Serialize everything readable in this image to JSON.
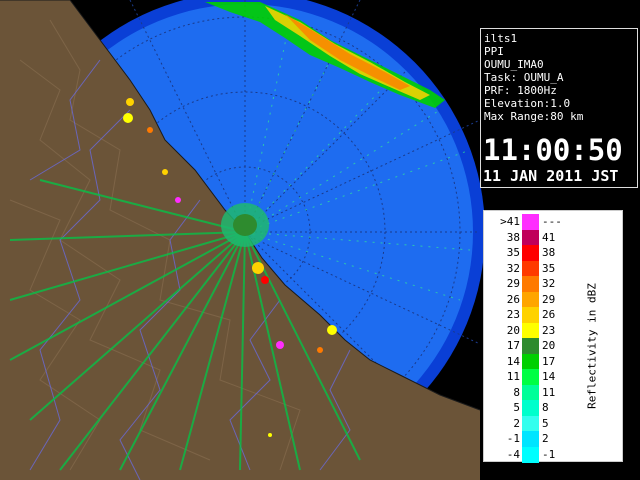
{
  "info_panel": {
    "site": "ilts1",
    "mode": "PPI",
    "product": "OUMU_IMA0",
    "task": "Task: OUMU_A",
    "prf": "PRF: 1800Hz",
    "elevation": "Elevation:1.0",
    "max_range": "Max Range:80 km",
    "time": "11:00:50",
    "date": "11 JAN 2011 JST"
  },
  "legend": {
    "title": "Reflectivity in dBZ",
    "rows": [
      {
        "lo": ">41",
        "hi": "---",
        "color": "#ff2dff"
      },
      {
        "lo": "38",
        "hi": "41",
        "color": "#c0005a"
      },
      {
        "lo": "35",
        "hi": "38",
        "color": "#ff0000"
      },
      {
        "lo": "32",
        "hi": "35",
        "color": "#ff3a00"
      },
      {
        "lo": "29",
        "hi": "32",
        "color": "#ff7a00"
      },
      {
        "lo": "26",
        "hi": "29",
        "color": "#ffa500"
      },
      {
        "lo": "23",
        "hi": "26",
        "color": "#ffd200"
      },
      {
        "lo": "20",
        "hi": "23",
        "color": "#ffff00"
      },
      {
        "lo": "17",
        "hi": "20",
        "color": "#2e8b2e"
      },
      {
        "lo": "14",
        "hi": "17",
        "color": "#00d000"
      },
      {
        "lo": "11",
        "hi": "14",
        "color": "#00ff44"
      },
      {
        "lo": "8",
        "hi": "11",
        "color": "#00ff99"
      },
      {
        "lo": "5",
        "hi": "8",
        "color": "#00ffcc"
      },
      {
        "lo": "2",
        "hi": "5",
        "color": "#33ffee"
      },
      {
        "lo": "-1",
        "hi": "2",
        "color": "#00e5ff"
      },
      {
        "lo": "-4",
        "hi": "-1",
        "color": "#00ffff"
      }
    ]
  },
  "map": {
    "sea_color": "#1e6cf0",
    "outer_sea_color": "#0a3fd6",
    "land_color": "#6b5438",
    "ring_color": "#1a3a8a"
  }
}
